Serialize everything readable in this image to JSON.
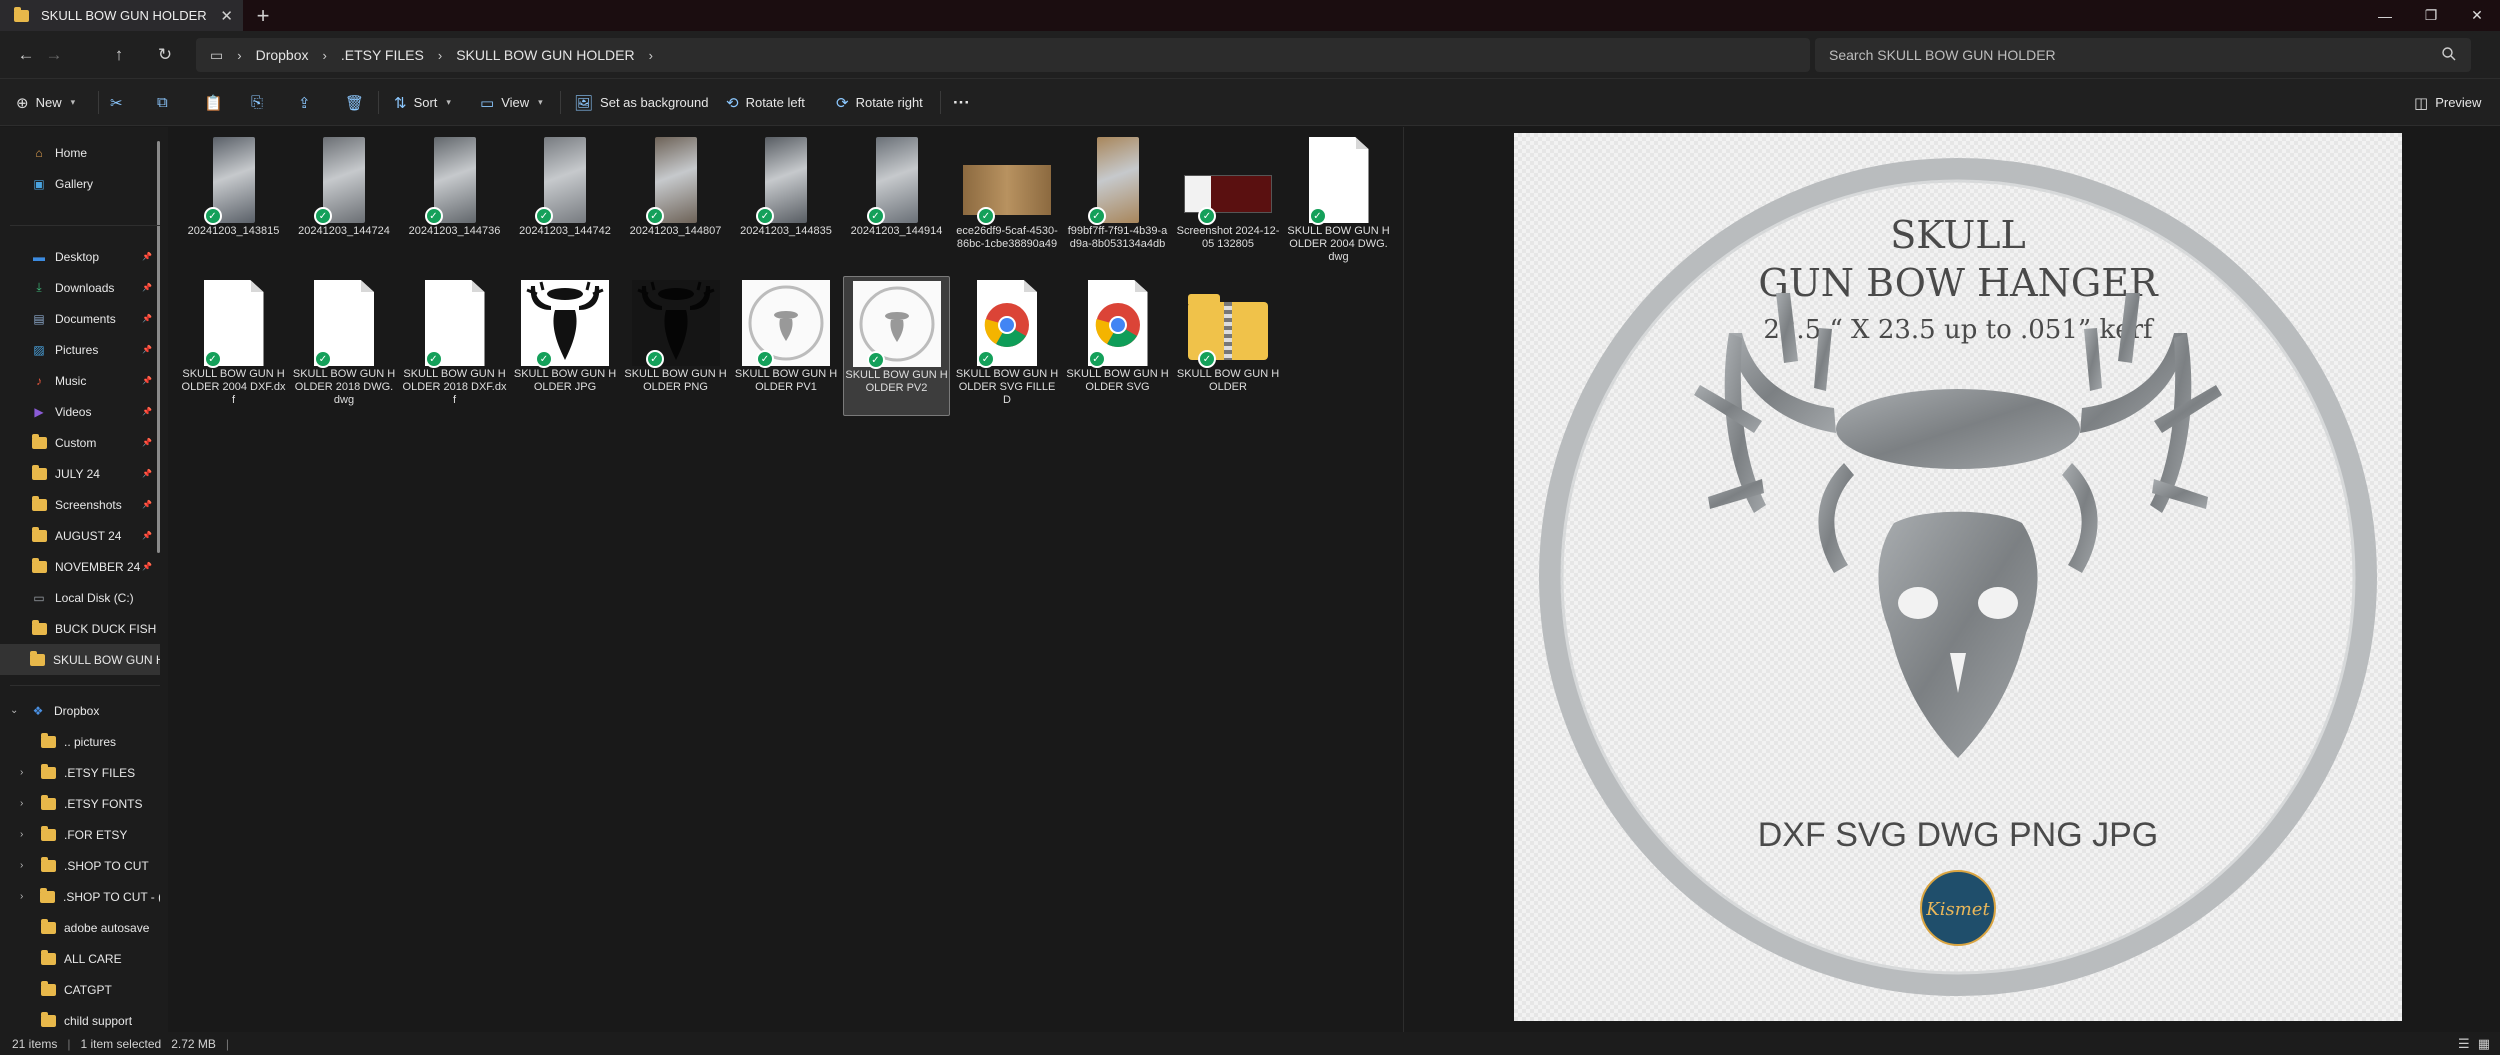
{
  "tab": {
    "title": "SKULL BOW GUN HOLDER"
  },
  "breadcrumb": [
    "Dropbox",
    ".ETSY FILES",
    "SKULL BOW GUN HOLDER"
  ],
  "search": {
    "placeholder": "Search SKULL BOW GUN HOLDER"
  },
  "toolbar": {
    "new_label": "New",
    "sort_label": "Sort",
    "view_label": "View",
    "set_bg_label": "Set as background",
    "rotate_left_label": "Rotate left",
    "rotate_right_label": "Rotate right",
    "more_label": "···",
    "preview_label": "Preview"
  },
  "sidebar": {
    "items": [
      {
        "label": "Home",
        "icon": "home-icon"
      },
      {
        "label": "Gallery",
        "icon": "gallery-icon"
      },
      {
        "label": "Desktop",
        "icon": "desktop-icon",
        "pinned": true
      },
      {
        "label": "Downloads",
        "icon": "download-icon",
        "pinned": true
      },
      {
        "label": "Documents",
        "icon": "document-icon",
        "pinned": true
      },
      {
        "label": "Pictures",
        "icon": "pictures-icon",
        "pinned": true
      },
      {
        "label": "Music",
        "icon": "music-icon",
        "pinned": true
      },
      {
        "label": "Videos",
        "icon": "video-icon",
        "pinned": true
      },
      {
        "label": "Custom",
        "icon": "folder-icon",
        "pinned": true
      },
      {
        "label": "JULY 24",
        "icon": "folder-icon",
        "pinned": true
      },
      {
        "label": "Screenshots",
        "icon": "folder-icon",
        "pinned": true
      },
      {
        "label": "AUGUST 24",
        "icon": "folder-icon",
        "pinned": true
      },
      {
        "label": "NOVEMBER 24",
        "icon": "folder-icon",
        "pinned": true
      },
      {
        "label": "Local Disk (C:)",
        "icon": "drive-icon"
      },
      {
        "label": "BUCK DUCK FISH",
        "icon": "folder-icon"
      },
      {
        "label": "SKULL BOW GUN H",
        "icon": "folder-icon"
      }
    ],
    "dropbox_label": "Dropbox",
    "dropbox_children": [
      ".. pictures",
      ".ETSY FILES",
      ".ETSY FONTS",
      ".FOR ETSY",
      ".SHOP TO CUT",
      ".SHOP TO CUT - (",
      "adobe autosave",
      "ALL CARE",
      "CATGPT",
      "child support"
    ]
  },
  "files": [
    {
      "name": "20241203_143815",
      "kind": "photo"
    },
    {
      "name": "20241203_144724",
      "kind": "photo"
    },
    {
      "name": "20241203_144736",
      "kind": "photo"
    },
    {
      "name": "20241203_144742",
      "kind": "photo"
    },
    {
      "name": "20241203_144807",
      "kind": "photo"
    },
    {
      "name": "20241203_144835",
      "kind": "photo"
    },
    {
      "name": "20241203_144914",
      "kind": "photo"
    },
    {
      "name": "ece26df9-5caf-4530-86bc-1cbe38890a49",
      "kind": "wide-photo"
    },
    {
      "name": "f99bf7ff-7f91-4b39-ad9a-8b053134a4db",
      "kind": "photo"
    },
    {
      "name": "Screenshot 2024-12-05 132805",
      "kind": "screenshot"
    },
    {
      "name": "SKULL BOW GUN HOLDER 2004 DWG.dwg",
      "kind": "doc"
    },
    {
      "name": "SKULL BOW GUN HOLDER 2004 DXF.dxf",
      "kind": "doc"
    },
    {
      "name": "SKULL BOW GUN HOLDER 2018 DWG.dwg",
      "kind": "doc"
    },
    {
      "name": "SKULL BOW GUN HOLDER 2018 DXF.dxf",
      "kind": "doc"
    },
    {
      "name": "SKULL BOW GUN HOLDER JPG",
      "kind": "skull-white"
    },
    {
      "name": "SKULL BOW GUN HOLDER PNG",
      "kind": "skull-dark"
    },
    {
      "name": "SKULL BOW GUN HOLDER PV1",
      "kind": "preview-thumb"
    },
    {
      "name": "SKULL BOW GUN HOLDER PV2",
      "kind": "preview-thumb",
      "selected": true
    },
    {
      "name": "SKULL BOW GUN HOLDER SVG FILLED",
      "kind": "chrome"
    },
    {
      "name": "SKULL BOW GUN HOLDER SVG",
      "kind": "chrome"
    },
    {
      "name": "SKULL BOW GUN HOLDER",
      "kind": "zip-folder"
    }
  ],
  "preview": {
    "line1": "SKULL",
    "line2": "GUN BOW HANGER",
    "line3": "23.5 “ X 23.5  up to .051” kerf",
    "formats": "DXF SVG DWG PNG JPG",
    "logo_text": "Kismet",
    "colors": {
      "ring": "#b9bcbe",
      "metal": "#8d9194",
      "badge": "#1f4e6b",
      "text": "#4a4a4a"
    }
  },
  "status": {
    "items": "21 items",
    "selected": "1 item selected",
    "size": "2.72 MB"
  }
}
